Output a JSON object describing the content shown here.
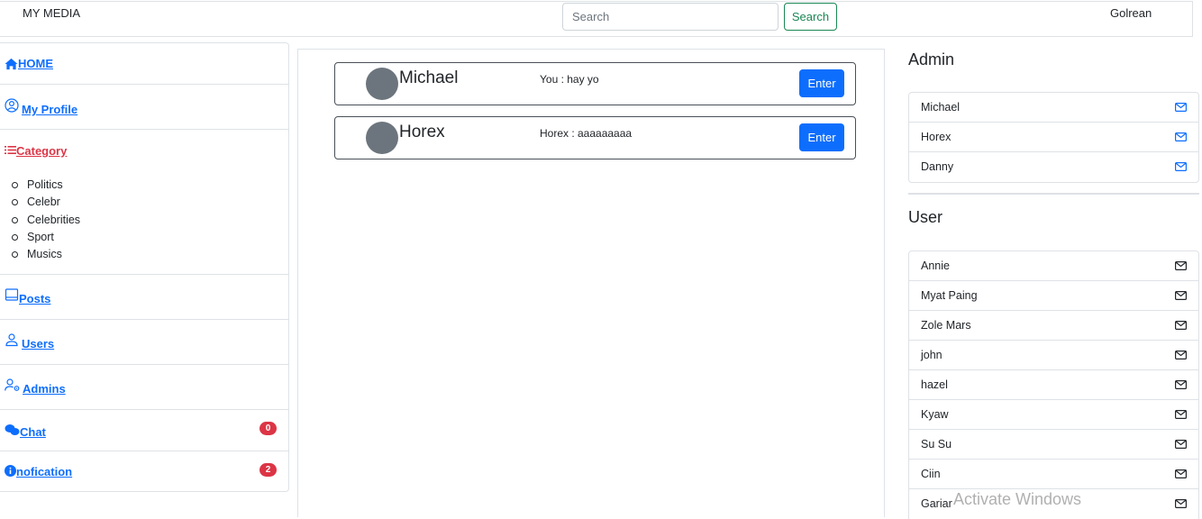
{
  "header": {
    "brand": "MY MEDIA",
    "search_placeholder": "Search",
    "search_button": "Search",
    "username": "Golrean"
  },
  "sidebar": {
    "home": "HOME",
    "profile": "My Profile",
    "category": "Category",
    "categories": [
      "Politics",
      "Celebr",
      "Celebrities",
      "Sport",
      "Musics"
    ],
    "posts": " Posts",
    "users": "Users",
    "admins": "Admins",
    "chat": "Chat",
    "chat_badge": "0",
    "notification": "nofication",
    "notification_badge": "2"
  },
  "chats": [
    {
      "name": "Michael",
      "message": "You : hay yo",
      "button": "Enter"
    },
    {
      "name": "Horex",
      "message": "Horex : aaaaaaaaa",
      "button": "Enter"
    }
  ],
  "admin_panel": {
    "title": "Admin",
    "items": [
      "Michael",
      "Horex",
      "Danny"
    ]
  },
  "user_panel": {
    "title": "User",
    "items": [
      "Annie",
      "Myat Paing",
      "Zole Mars",
      "john",
      "hazel",
      "Kyaw",
      "Su Su",
      "Ciin",
      "Gariar"
    ]
  },
  "colors": {
    "link": "#0d6efd",
    "active_link": "#dc3545",
    "badge": "#dc3545",
    "search_button": "#198754",
    "enter_button": "#0d6efd"
  },
  "watermark": "Activate Windows"
}
